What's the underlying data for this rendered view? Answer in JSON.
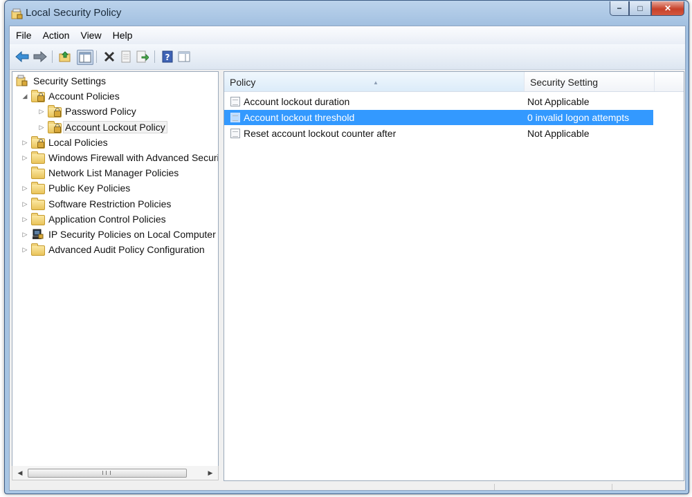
{
  "window": {
    "title": "Local Security Policy"
  },
  "window_buttons": {
    "minimize": "−",
    "maximize": "□",
    "close": "✕"
  },
  "menu": [
    "File",
    "Action",
    "View",
    "Help"
  ],
  "toolbar": {
    "buttons": [
      "back-icon",
      "forward-icon",
      "up-folder-icon",
      "show-hide-tree-icon",
      "delete-icon",
      "properties-icon",
      "export-list-icon",
      "help-icon",
      "action-pane-icon"
    ]
  },
  "tree": {
    "items": [
      {
        "label": "Security Settings"
      },
      {
        "label": "Account Policies"
      },
      {
        "label": "Password Policy"
      },
      {
        "label": "Account Lockout Policy"
      },
      {
        "label": "Local Policies"
      },
      {
        "label": "Windows Firewall with Advanced Security"
      },
      {
        "label": "Network List Manager Policies"
      },
      {
        "label": "Public Key Policies"
      },
      {
        "label": "Software Restriction Policies"
      },
      {
        "label": "Application Control Policies"
      },
      {
        "label": "IP Security Policies on Local Computer"
      },
      {
        "label": "Advanced Audit Policy Configuration"
      }
    ]
  },
  "list": {
    "columns": {
      "policy": "Policy",
      "setting": "Security Setting"
    },
    "rows": [
      {
        "policy": "Account lockout duration",
        "setting": "Not Applicable"
      },
      {
        "policy": "Account lockout threshold",
        "setting": "0 invalid logon attempts"
      },
      {
        "policy": "Reset account lockout counter after",
        "setting": "Not Applicable"
      }
    ]
  },
  "colors": {
    "selection": "#3399ff",
    "accent": "#9fbedf"
  }
}
